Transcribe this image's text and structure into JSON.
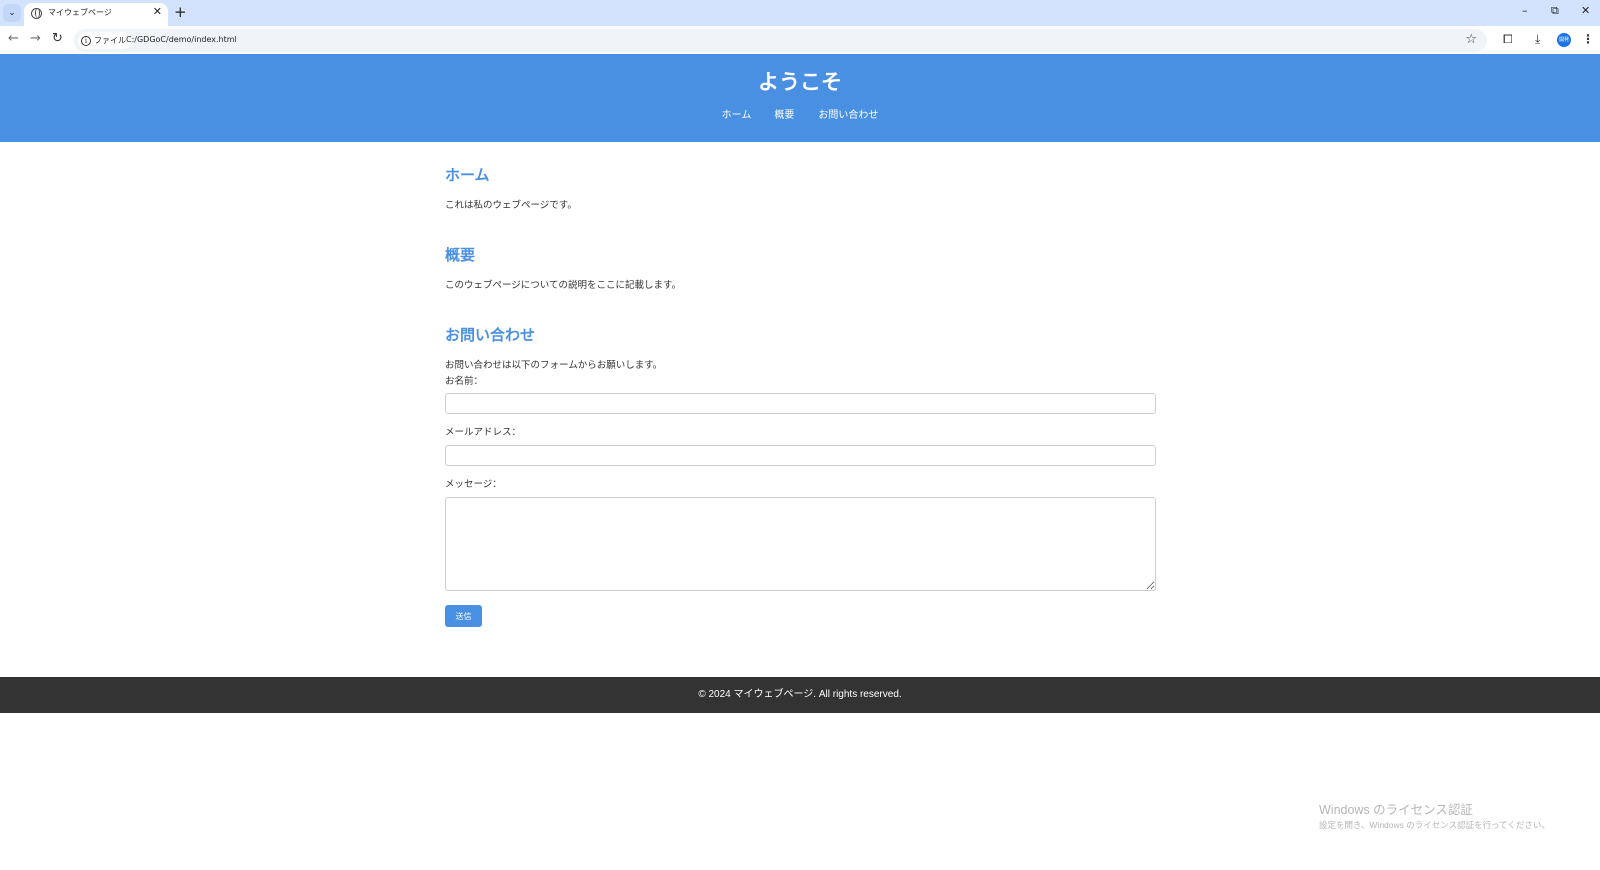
{
  "browser": {
    "tab_title": "マイウェブページ",
    "tab_close": "✕",
    "new_tab": "+",
    "window_controls": {
      "minimize": "–",
      "restore": "⧉",
      "close": "✕"
    },
    "site_chip_label": "ファイル",
    "url": "C:/GDGoC/demo/index.html",
    "profile_initials": "開発"
  },
  "header": {
    "title": "ようこそ",
    "nav": [
      "ホーム",
      "概要",
      "お問い合わせ"
    ]
  },
  "home": {
    "heading": "ホーム",
    "text": "これは私のウェブページです。"
  },
  "about": {
    "heading": "概要",
    "text": "このウェブページについての説明をここに記載します。"
  },
  "contact": {
    "heading": "お問い合わせ",
    "intro": "お問い合わせは以下のフォームからお願いします。",
    "name_label": "お名前：",
    "email_label": "メールアドレス：",
    "message_label": "メッセージ：",
    "name_value": "",
    "email_value": "",
    "message_value": "",
    "submit_label": "送信"
  },
  "footer": {
    "text": "© 2024 マイウェブページ. All rights reserved."
  },
  "watermark": {
    "title": "Windows のライセンス認証",
    "subtitle": "設定を開き、Windows のライセンス認証を行ってください。"
  },
  "colors": {
    "accent": "#4a90e2",
    "footer_bg": "#333333",
    "tabstrip_bg": "#d3e3fd"
  },
  "icons": {
    "tab_list": "chevron-down-icon",
    "favicon": "globe-icon",
    "back": "arrow-left-icon",
    "forward": "arrow-right-icon",
    "reload": "reload-icon",
    "site_info": "info-icon",
    "bookmark": "star-icon",
    "extensions": "puzzle-icon",
    "downloads": "download-icon",
    "menu": "kebab-menu-icon"
  }
}
